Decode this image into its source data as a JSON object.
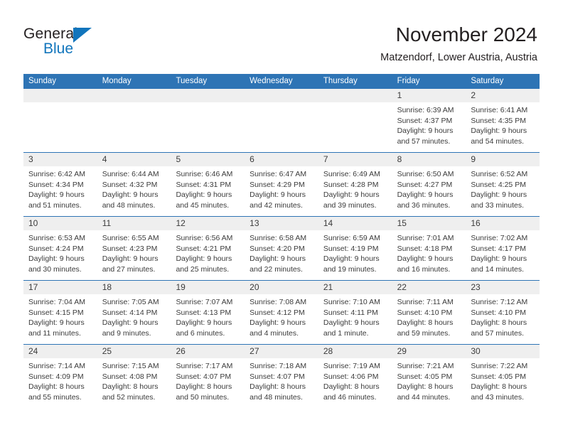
{
  "logo": {
    "word1": "General",
    "word2": "Blue",
    "triangle_color": "#1175bc"
  },
  "header": {
    "title": "November 2024",
    "subtitle": "Matzendorf, Lower Austria, Austria"
  },
  "theme": {
    "header_blue": "#2e74b5",
    "daynum_band": "#efefef",
    "text": "#3b3b3b"
  },
  "weekday_headers": [
    "Sunday",
    "Monday",
    "Tuesday",
    "Wednesday",
    "Thursday",
    "Friday",
    "Saturday"
  ],
  "labels": {
    "sunrise_prefix": "Sunrise:",
    "sunset_prefix": "Sunset:",
    "daylight_prefix": "Daylight:"
  },
  "weeks": [
    [
      {
        "day": "",
        "empty": true,
        "l1": "",
        "l2": "",
        "l3": "",
        "l4": ""
      },
      {
        "day": "",
        "empty": true,
        "l1": "",
        "l2": "",
        "l3": "",
        "l4": ""
      },
      {
        "day": "",
        "empty": true,
        "l1": "",
        "l2": "",
        "l3": "",
        "l4": ""
      },
      {
        "day": "",
        "empty": true,
        "l1": "",
        "l2": "",
        "l3": "",
        "l4": ""
      },
      {
        "day": "",
        "empty": true,
        "l1": "",
        "l2": "",
        "l3": "",
        "l4": ""
      },
      {
        "day": "1",
        "empty": false,
        "l1": "Sunrise: 6:39 AM",
        "l2": "Sunset: 4:37 PM",
        "l3": "Daylight: 9 hours",
        "l4": "and 57 minutes."
      },
      {
        "day": "2",
        "empty": false,
        "l1": "Sunrise: 6:41 AM",
        "l2": "Sunset: 4:35 PM",
        "l3": "Daylight: 9 hours",
        "l4": "and 54 minutes."
      }
    ],
    [
      {
        "day": "3",
        "empty": false,
        "l1": "Sunrise: 6:42 AM",
        "l2": "Sunset: 4:34 PM",
        "l3": "Daylight: 9 hours",
        "l4": "and 51 minutes."
      },
      {
        "day": "4",
        "empty": false,
        "l1": "Sunrise: 6:44 AM",
        "l2": "Sunset: 4:32 PM",
        "l3": "Daylight: 9 hours",
        "l4": "and 48 minutes."
      },
      {
        "day": "5",
        "empty": false,
        "l1": "Sunrise: 6:46 AM",
        "l2": "Sunset: 4:31 PM",
        "l3": "Daylight: 9 hours",
        "l4": "and 45 minutes."
      },
      {
        "day": "6",
        "empty": false,
        "l1": "Sunrise: 6:47 AM",
        "l2": "Sunset: 4:29 PM",
        "l3": "Daylight: 9 hours",
        "l4": "and 42 minutes."
      },
      {
        "day": "7",
        "empty": false,
        "l1": "Sunrise: 6:49 AM",
        "l2": "Sunset: 4:28 PM",
        "l3": "Daylight: 9 hours",
        "l4": "and 39 minutes."
      },
      {
        "day": "8",
        "empty": false,
        "l1": "Sunrise: 6:50 AM",
        "l2": "Sunset: 4:27 PM",
        "l3": "Daylight: 9 hours",
        "l4": "and 36 minutes."
      },
      {
        "day": "9",
        "empty": false,
        "l1": "Sunrise: 6:52 AM",
        "l2": "Sunset: 4:25 PM",
        "l3": "Daylight: 9 hours",
        "l4": "and 33 minutes."
      }
    ],
    [
      {
        "day": "10",
        "empty": false,
        "l1": "Sunrise: 6:53 AM",
        "l2": "Sunset: 4:24 PM",
        "l3": "Daylight: 9 hours",
        "l4": "and 30 minutes."
      },
      {
        "day": "11",
        "empty": false,
        "l1": "Sunrise: 6:55 AM",
        "l2": "Sunset: 4:23 PM",
        "l3": "Daylight: 9 hours",
        "l4": "and 27 minutes."
      },
      {
        "day": "12",
        "empty": false,
        "l1": "Sunrise: 6:56 AM",
        "l2": "Sunset: 4:21 PM",
        "l3": "Daylight: 9 hours",
        "l4": "and 25 minutes."
      },
      {
        "day": "13",
        "empty": false,
        "l1": "Sunrise: 6:58 AM",
        "l2": "Sunset: 4:20 PM",
        "l3": "Daylight: 9 hours",
        "l4": "and 22 minutes."
      },
      {
        "day": "14",
        "empty": false,
        "l1": "Sunrise: 6:59 AM",
        "l2": "Sunset: 4:19 PM",
        "l3": "Daylight: 9 hours",
        "l4": "and 19 minutes."
      },
      {
        "day": "15",
        "empty": false,
        "l1": "Sunrise: 7:01 AM",
        "l2": "Sunset: 4:18 PM",
        "l3": "Daylight: 9 hours",
        "l4": "and 16 minutes."
      },
      {
        "day": "16",
        "empty": false,
        "l1": "Sunrise: 7:02 AM",
        "l2": "Sunset: 4:17 PM",
        "l3": "Daylight: 9 hours",
        "l4": "and 14 minutes."
      }
    ],
    [
      {
        "day": "17",
        "empty": false,
        "l1": "Sunrise: 7:04 AM",
        "l2": "Sunset: 4:15 PM",
        "l3": "Daylight: 9 hours",
        "l4": "and 11 minutes."
      },
      {
        "day": "18",
        "empty": false,
        "l1": "Sunrise: 7:05 AM",
        "l2": "Sunset: 4:14 PM",
        "l3": "Daylight: 9 hours",
        "l4": "and 9 minutes."
      },
      {
        "day": "19",
        "empty": false,
        "l1": "Sunrise: 7:07 AM",
        "l2": "Sunset: 4:13 PM",
        "l3": "Daylight: 9 hours",
        "l4": "and 6 minutes."
      },
      {
        "day": "20",
        "empty": false,
        "l1": "Sunrise: 7:08 AM",
        "l2": "Sunset: 4:12 PM",
        "l3": "Daylight: 9 hours",
        "l4": "and 4 minutes."
      },
      {
        "day": "21",
        "empty": false,
        "l1": "Sunrise: 7:10 AM",
        "l2": "Sunset: 4:11 PM",
        "l3": "Daylight: 9 hours",
        "l4": "and 1 minute."
      },
      {
        "day": "22",
        "empty": false,
        "l1": "Sunrise: 7:11 AM",
        "l2": "Sunset: 4:10 PM",
        "l3": "Daylight: 8 hours",
        "l4": "and 59 minutes."
      },
      {
        "day": "23",
        "empty": false,
        "l1": "Sunrise: 7:12 AM",
        "l2": "Sunset: 4:10 PM",
        "l3": "Daylight: 8 hours",
        "l4": "and 57 minutes."
      }
    ],
    [
      {
        "day": "24",
        "empty": false,
        "l1": "Sunrise: 7:14 AM",
        "l2": "Sunset: 4:09 PM",
        "l3": "Daylight: 8 hours",
        "l4": "and 55 minutes."
      },
      {
        "day": "25",
        "empty": false,
        "l1": "Sunrise: 7:15 AM",
        "l2": "Sunset: 4:08 PM",
        "l3": "Daylight: 8 hours",
        "l4": "and 52 minutes."
      },
      {
        "day": "26",
        "empty": false,
        "l1": "Sunrise: 7:17 AM",
        "l2": "Sunset: 4:07 PM",
        "l3": "Daylight: 8 hours",
        "l4": "and 50 minutes."
      },
      {
        "day": "27",
        "empty": false,
        "l1": "Sunrise: 7:18 AM",
        "l2": "Sunset: 4:07 PM",
        "l3": "Daylight: 8 hours",
        "l4": "and 48 minutes."
      },
      {
        "day": "28",
        "empty": false,
        "l1": "Sunrise: 7:19 AM",
        "l2": "Sunset: 4:06 PM",
        "l3": "Daylight: 8 hours",
        "l4": "and 46 minutes."
      },
      {
        "day": "29",
        "empty": false,
        "l1": "Sunrise: 7:21 AM",
        "l2": "Sunset: 4:05 PM",
        "l3": "Daylight: 8 hours",
        "l4": "and 44 minutes."
      },
      {
        "day": "30",
        "empty": false,
        "l1": "Sunrise: 7:22 AM",
        "l2": "Sunset: 4:05 PM",
        "l3": "Daylight: 8 hours",
        "l4": "and 43 minutes."
      }
    ]
  ]
}
